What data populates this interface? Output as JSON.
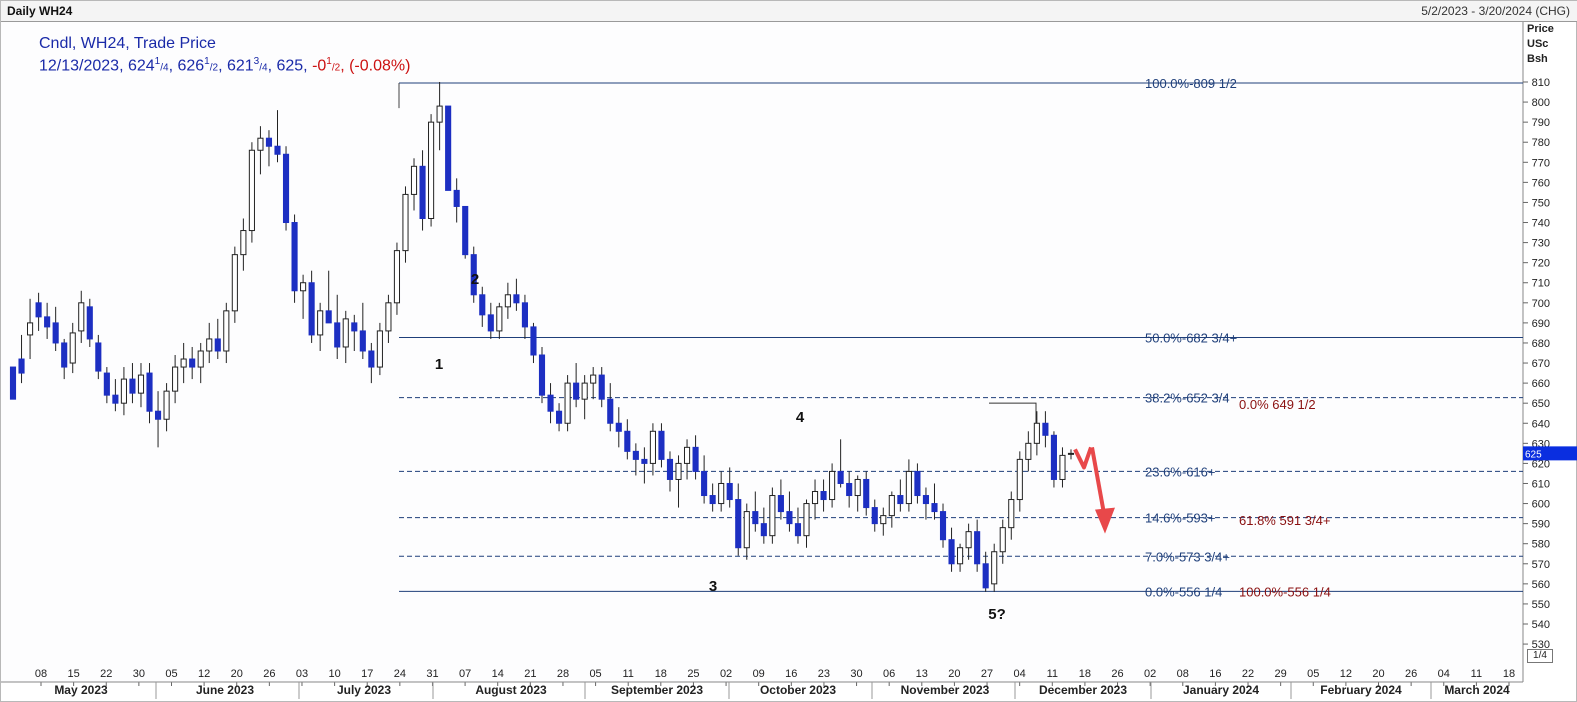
{
  "header": {
    "title": "Daily WH24",
    "date_range": "5/2/2023 - 3/20/2024 (CHG)"
  },
  "legend": {
    "line1": "Cndl, WH24, Trade Price",
    "line2_prefix": "12/13/2023, 624",
    "line2_sup1": "1",
    "line2_sub1": "/4",
    "line2_a": ", 626",
    "line2_sup2": "1",
    "line2_sub2": "/2",
    "line2_b": ", 621",
    "line2_sup3": "3",
    "line2_sub3": "/4",
    "line2_c": ", 625, ",
    "line2_chg": "-0",
    "line2_sup4": "1",
    "line2_sub4": "/2",
    "line2_pct": ", (-0.08%)"
  },
  "axis_header": {
    "l1": "Price",
    "l2": "USc",
    "l3": "Bsh"
  },
  "page_indicator": "1/4",
  "last_price_tag": "625",
  "colors": {
    "down_candle": "#1d2fc2",
    "up_candle": "#ffffff",
    "fib_line": "#1f3f7a",
    "arrow": "#e8484a",
    "price_tag": "#0a2ee0"
  },
  "chart_data": {
    "type": "candlestick",
    "ylim": [
      520,
      825
    ],
    "yticks": [
      530,
      540,
      550,
      560,
      570,
      580,
      590,
      600,
      610,
      620,
      630,
      640,
      650,
      660,
      670,
      680,
      690,
      700,
      710,
      720,
      730,
      740,
      750,
      760,
      770,
      780,
      790,
      800,
      810
    ],
    "day_labels": [
      "08",
      "15",
      "22",
      "30",
      "05",
      "12",
      "20",
      "26",
      "03",
      "10",
      "17",
      "24",
      "31",
      "07",
      "14",
      "21",
      "28",
      "05",
      "11",
      "18",
      "25",
      "02",
      "09",
      "16",
      "23",
      "30",
      "06",
      "13",
      "20",
      "27",
      "04",
      "11",
      "18",
      "26",
      "02",
      "08",
      "16",
      "22",
      "29",
      "05",
      "12",
      "20",
      "26",
      "04",
      "11",
      "18"
    ],
    "months": [
      "May 2023",
      "June 2023",
      "July 2023",
      "August 2023",
      "September 2023",
      "October 2023",
      "November 2023",
      "December 2023",
      "January 2024",
      "February 2024",
      "March 2024"
    ],
    "fib_levels": [
      {
        "label": "100.0%-809 1/2",
        "price": 809.5,
        "style": "solid"
      },
      {
        "label": "50.0%-682 3/4+",
        "price": 682.75,
        "style": "solid"
      },
      {
        "label": "38.2%-652 3/4",
        "price": 652.75,
        "style": "dashed"
      },
      {
        "label": "23.6%-616+",
        "price": 616,
        "style": "dashed"
      },
      {
        "label": "14.6%-593+",
        "price": 593,
        "style": "dashed"
      },
      {
        "label": "7.0%-573 3/4+",
        "price": 573.75,
        "style": "dashed"
      },
      {
        "label": "0.0%-556 1/4",
        "price": 556.25,
        "style": "solid"
      }
    ],
    "fib_ext_labels": [
      {
        "label": "0.0%   649 1/2",
        "price": 649.5
      },
      {
        "label": "61.8%   591 3/4+",
        "price": 591.75
      },
      {
        "label": "100.0%-556 1/4",
        "price": 556.25
      }
    ],
    "wave_labels": [
      "1",
      "2",
      "3",
      "4",
      "5?"
    ],
    "candles": [
      [
        668,
        660,
        660,
        652
      ],
      [
        672,
        684,
        660,
        665
      ],
      [
        684,
        702,
        672,
        690
      ],
      [
        700,
        705,
        686,
        693
      ],
      [
        693,
        700,
        682,
        688
      ],
      [
        690,
        698,
        676,
        680
      ],
      [
        680,
        682,
        662,
        668
      ],
      [
        670,
        690,
        665,
        685
      ],
      [
        686,
        706,
        680,
        700
      ],
      [
        698,
        702,
        678,
        682
      ],
      [
        680,
        684,
        662,
        666
      ],
      [
        665,
        668,
        650,
        654
      ],
      [
        654,
        662,
        646,
        650
      ],
      [
        650,
        668,
        644,
        662
      ],
      [
        662,
        670,
        650,
        655
      ],
      [
        655,
        670,
        648,
        664
      ],
      [
        665,
        670,
        640,
        646
      ],
      [
        646,
        656,
        628,
        642
      ],
      [
        642,
        660,
        636,
        656
      ],
      [
        656,
        674,
        650,
        668
      ],
      [
        668,
        680,
        660,
        672
      ],
      [
        672,
        678,
        662,
        668
      ],
      [
        668,
        680,
        660,
        676
      ],
      [
        676,
        690,
        670,
        682
      ],
      [
        682,
        692,
        672,
        676
      ],
      [
        676,
        700,
        670,
        696
      ],
      [
        696,
        728,
        690,
        724
      ],
      [
        724,
        742,
        716,
        736
      ],
      [
        736,
        780,
        730,
        776
      ],
      [
        776,
        788,
        764,
        782
      ],
      [
        782,
        786,
        768,
        778
      ],
      [
        778,
        796,
        770,
        774
      ],
      [
        774,
        778,
        736,
        740
      ],
      [
        740,
        744,
        700,
        706
      ],
      [
        706,
        714,
        692,
        710
      ],
      [
        710,
        716,
        680,
        684
      ],
      [
        684,
        700,
        676,
        696
      ],
      [
        696,
        716,
        690,
        690
      ],
      [
        690,
        704,
        672,
        678
      ],
      [
        678,
        696,
        670,
        692
      ],
      [
        690,
        694,
        676,
        686
      ],
      [
        686,
        700,
        672,
        676
      ],
      [
        676,
        680,
        660,
        668
      ],
      [
        668,
        690,
        664,
        686
      ],
      [
        686,
        704,
        680,
        700
      ],
      [
        700,
        730,
        694,
        726
      ],
      [
        726,
        758,
        720,
        754
      ],
      [
        754,
        772,
        746,
        768
      ],
      [
        768,
        776,
        736,
        742
      ],
      [
        742,
        794,
        738,
        790
      ],
      [
        790,
        810,
        776,
        798
      ],
      [
        798,
        794,
        756,
        756
      ],
      [
        756,
        762,
        740,
        748
      ],
      [
        748,
        740,
        722,
        724
      ],
      [
        724,
        728,
        700,
        704
      ],
      [
        704,
        708,
        688,
        694
      ],
      [
        694,
        700,
        682,
        686
      ],
      [
        686,
        700,
        682,
        698
      ],
      [
        698,
        710,
        692,
        704
      ],
      [
        704,
        712,
        696,
        700
      ],
      [
        700,
        704,
        682,
        688
      ],
      [
        688,
        690,
        670,
        674
      ],
      [
        674,
        678,
        650,
        654
      ],
      [
        654,
        660,
        640,
        646
      ],
      [
        646,
        650,
        636,
        640
      ],
      [
        640,
        664,
        636,
        660
      ],
      [
        660,
        670,
        648,
        652
      ],
      [
        652,
        664,
        642,
        660
      ],
      [
        660,
        668,
        652,
        664
      ],
      [
        664,
        668,
        648,
        652
      ],
      [
        652,
        660,
        636,
        640
      ],
      [
        640,
        648,
        628,
        636
      ],
      [
        636,
        642,
        622,
        626
      ],
      [
        626,
        630,
        614,
        622
      ],
      [
        622,
        628,
        610,
        620
      ],
      [
        620,
        640,
        614,
        636
      ],
      [
        636,
        640,
        618,
        622
      ],
      [
        622,
        626,
        606,
        612
      ],
      [
        612,
        624,
        598,
        620
      ],
      [
        620,
        632,
        612,
        628
      ],
      [
        628,
        634,
        612,
        616
      ],
      [
        616,
        624,
        600,
        604
      ],
      [
        604,
        610,
        596,
        600
      ],
      [
        600,
        616,
        596,
        610
      ],
      [
        610,
        618,
        598,
        602
      ],
      [
        602,
        610,
        574,
        578
      ],
      [
        578,
        600,
        572,
        596
      ],
      [
        596,
        606,
        586,
        590
      ],
      [
        590,
        598,
        580,
        584
      ],
      [
        584,
        608,
        580,
        604
      ],
      [
        604,
        612,
        592,
        596
      ],
      [
        596,
        606,
        586,
        590
      ],
      [
        590,
        598,
        580,
        584
      ],
      [
        584,
        602,
        578,
        600
      ],
      [
        600,
        612,
        592,
        606
      ],
      [
        606,
        612,
        596,
        602
      ],
      [
        602,
        620,
        598,
        616
      ],
      [
        616,
        632,
        608,
        610
      ],
      [
        610,
        616,
        598,
        604
      ],
      [
        604,
        614,
        596,
        612
      ],
      [
        612,
        616,
        594,
        598
      ],
      [
        598,
        602,
        586,
        590
      ],
      [
        590,
        598,
        584,
        594
      ],
      [
        594,
        606,
        588,
        604
      ],
      [
        604,
        612,
        596,
        600
      ],
      [
        600,
        622,
        596,
        616
      ],
      [
        616,
        620,
        600,
        604
      ],
      [
        604,
        608,
        592,
        600
      ],
      [
        600,
        610,
        592,
        596
      ],
      [
        596,
        600,
        578,
        582
      ],
      [
        582,
        588,
        566,
        570
      ],
      [
        570,
        580,
        566,
        578
      ],
      [
        578,
        590,
        572,
        586
      ],
      [
        586,
        592,
        566,
        570
      ],
      [
        570,
        576,
        556,
        558
      ],
      [
        560,
        580,
        556,
        576
      ],
      [
        576,
        592,
        570,
        588
      ],
      [
        588,
        606,
        582,
        602
      ],
      [
        602,
        626,
        596,
        622
      ],
      [
        622,
        636,
        616,
        630
      ],
      [
        630,
        646,
        624,
        640
      ],
      [
        640,
        646,
        628,
        634
      ],
      [
        634,
        636,
        608,
        612
      ],
      [
        612,
        628,
        608,
        624
      ],
      [
        625,
        627,
        622,
        625
      ]
    ]
  }
}
